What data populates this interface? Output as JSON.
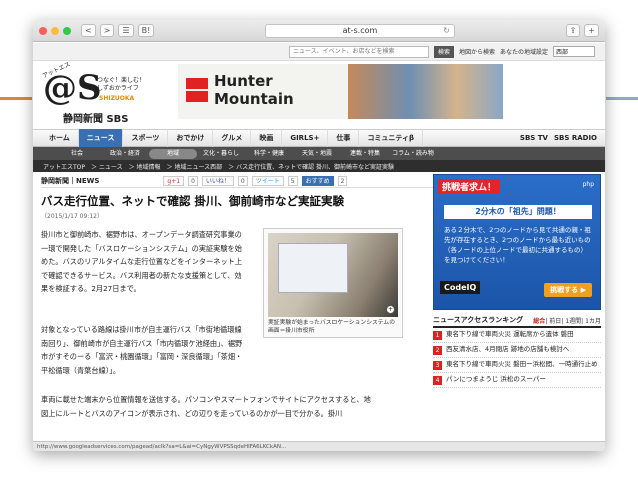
{
  "browser": {
    "url": "at-s.com",
    "buttons": {
      "back": "<",
      "forward": ">",
      "sidebar": "☰",
      "bookmark": "B!"
    }
  },
  "topbar": {
    "search_placeholder": "ニュース、イベント、お店などを検索",
    "search_button": "検索",
    "map_search": "地図から検索",
    "region_label": "あなたの地域設定",
    "region_value": "西部"
  },
  "logo": {
    "at_text": "@S",
    "kana": "アットエス",
    "tagline_1": "つなぐ！楽しむ！",
    "tagline_2": "しずおかライフ",
    "shizuoka": "SHIZUOKA",
    "brand": "静岡新聞 SBS"
  },
  "banner": {
    "line1": "Hunter",
    "line2": "Mountain"
  },
  "nav": {
    "items": [
      "ホーム",
      "ニュース",
      "スポーツ",
      "おでかけ",
      "グルメ",
      "映画",
      "GIRLS+",
      "仕事",
      "コミュニティβ"
    ],
    "active_index": 1,
    "right": [
      "SBS TV",
      "SBS RADIO"
    ]
  },
  "subnav": {
    "items": [
      "社会",
      "政治・経済",
      "地域",
      "文化・暮らし",
      "科学・健康",
      "天気・地震",
      "連載・特集",
      "コラム・読み物"
    ],
    "active_index": 2
  },
  "breadcrumb": [
    "アットエスTOP",
    "＞ ニュース",
    "＞ 地域情報",
    "＞ 地域ニュース西部",
    "＞ バス走行位置、ネットで確認 掛川、御前崎市など実証実験"
  ],
  "article": {
    "source": "静岡新聞｜NEWS",
    "share": {
      "gplus": "g+1",
      "gplus_count": "0",
      "fb": "いいね！",
      "fb_count": "0",
      "tw": "ツイート",
      "tw_count": "5",
      "bm": "おすすめ",
      "bm_count": "2"
    },
    "headline": "バス走行位置、ネットで確認 掛川、御前崎市など実証実験",
    "date": "（2015/1/17 09:12）",
    "para1": "掛川市と御前崎市、裾野市は、オープンデータ調査研究事業の一環で開発した「バスロケーションシステム」の実証実験を始めた。バスのリアルタイムな走行位置などをインターネット上で確認できるサービス。バス利用者の新たな支援策として、効果を検証する。2月27日まで。",
    "para2": "対象となっている路線は掛川市が自主運行バス「市街地循環線南回り」、御前崎市が自主運行バス「市内循環ケ池経由」、裾野市がすそのーる「富沢・桃園循環」「富岡・深良循環」「茶畑・平松循環（青葉台線）」。",
    "para3": "車両に載せた端末から位置情報を送信する。パソコンやスマートフォンでサイトにアクセスすると、地図上にルートとバスのアイコンが表示され、どの辺りを走っているのかが一目で分かる。掛川",
    "photo_caption": "実証実験が始まったバスロケーションシステムの画面＝掛川市役所"
  },
  "ad": {
    "top": "挑戦者求ム！",
    "title": "2分木の「祖先」問題！",
    "body": "ある２分木で、2つのノードから見て共通の親・祖先が存在するとき、2つのノードから最も近いもの（各ノードの上位ノードで最初に共通するもの）を見つけてください！",
    "logo": "CodeIQ",
    "button": "挑戦する ▶",
    "badge": "php"
  },
  "ranking": {
    "title": "ニュースアクセスランキング",
    "tabs": [
      "総合",
      "前日",
      "1週間",
      "1カ月"
    ],
    "active_tab": 0,
    "items": [
      {
        "num": "1",
        "text": "東名下り線で車両火災 運転席から遺体 磐田"
      },
      {
        "num": "2",
        "text": "西友清水店、4月閉店 跡地の店舗も検討へ"
      },
      {
        "num": "3",
        "text": "東名下り線で車両火災 磐田ー浜松間、一時通行止め"
      },
      {
        "num": "4",
        "text": "パンにつまようじ 浜松のスーパー"
      }
    ]
  },
  "status": "http://www.googleadservices.com/pagead/aclk?sa=L&ai=CyNgyWVPSSqdeHIFA6LKCkAN...",
  "colors": {
    "accent": "#3a6fb0",
    "ranking": "#d22222",
    "ad_bg": "#2a6ec9",
    "deco_left": "#d9893a",
    "deco_right": "#8fa9c6"
  }
}
